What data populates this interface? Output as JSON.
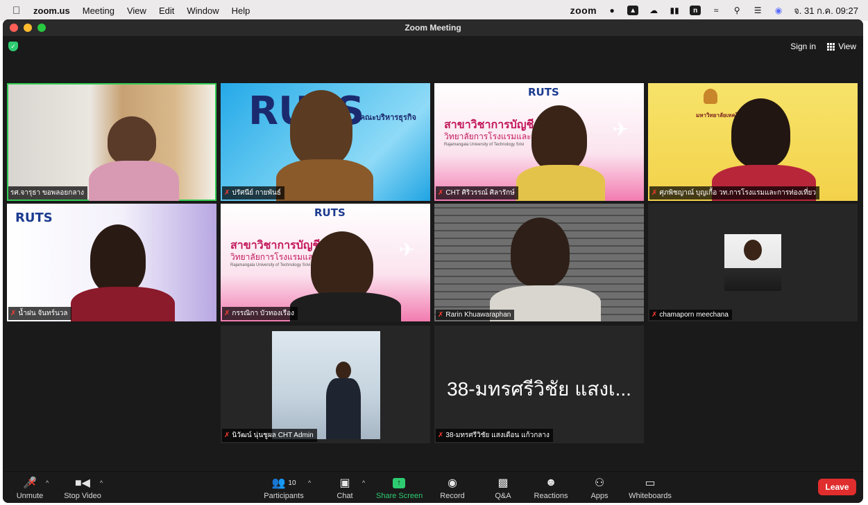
{
  "menubar": {
    "app": "zoom.us",
    "items": [
      "Meeting",
      "View",
      "Edit",
      "Window",
      "Help"
    ],
    "right_logo": "zoom",
    "date_time": "จ. 31 ก.ค. 09:27",
    "icons": [
      "line-icon",
      "record-icon",
      "drive-icon",
      "battery-icon",
      "n-icon",
      "wifi-icon",
      "search-icon",
      "control-center-icon",
      "siri-icon"
    ]
  },
  "window": {
    "title": "Zoom Meeting"
  },
  "topbar": {
    "sign_in": "Sign in",
    "view": "View"
  },
  "participants": [
    {
      "name": "รศ.จารุธา ขอพลอยกลาง",
      "muted": false,
      "active": true
    },
    {
      "name": "ปรัศนีย์ กายพันธ์",
      "muted": true
    },
    {
      "name": "CHT ศิริวรรณ์ ศิลารักษ์",
      "muted": true
    },
    {
      "name": "ศุภพิชญาณ์ บุญเกื้อ วท.การโรงแรมและการท่องเที่ยว",
      "muted": true
    },
    {
      "name": "น้ำฝน จันทร์นวล",
      "muted": true
    },
    {
      "name": "กรรณิกา บัวทองเรือง",
      "muted": true
    },
    {
      "name": "Rarin Khuawaraphan",
      "muted": true
    },
    {
      "name": "chamaporn meechana",
      "muted": true
    },
    {
      "name": "นิวัฒน์ นุ่นชูผล CHT Admin",
      "muted": true
    },
    {
      "name": "38-มทรศรีวิชัย แสงเดือน แก้วกลาง",
      "muted": true,
      "display_text": "38-มทรศรีวิชัย แสงเ..."
    }
  ],
  "backgrounds": {
    "ruts": "RUTS",
    "faculty": "คณะบริหารธุรกิจ",
    "accounting": "สาขาวิชาการบัญชี",
    "college": "วิทยาลัยการโรงแรมและก",
    "rajamangala": "Rajamangala University of Technology Srivi",
    "yellow_header": "มหาวิทยาลัยเทคโนโลยีราชมง"
  },
  "toolbar": {
    "unmute": "Unmute",
    "stop_video": "Stop Video",
    "participants": "Participants",
    "participants_count": "10",
    "chat": "Chat",
    "share_screen": "Share Screen",
    "record": "Record",
    "qa": "Q&A",
    "reactions": "Reactions",
    "apps": "Apps",
    "whiteboards": "Whiteboards",
    "leave": "Leave"
  },
  "colors": {
    "active_speaker": "#33cc55",
    "share_green": "#2ecc71",
    "leave_red": "#e02d2d",
    "muted_red": "#ff3b30"
  }
}
